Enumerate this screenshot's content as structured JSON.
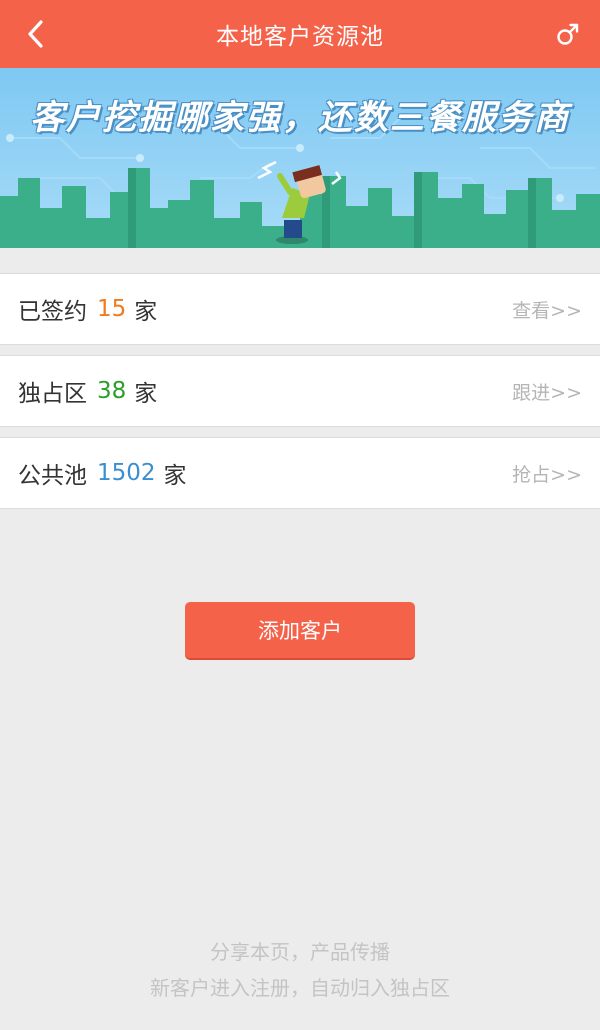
{
  "header": {
    "title": "本地客户资源池",
    "back_icon": "chevron-left-icon",
    "right_icon": "male-symbol-icon",
    "color": "#f5624a"
  },
  "banner": {
    "slogan": "客户挖掘哪家强，还数三餐服务商"
  },
  "rows": [
    {
      "label": "已签约",
      "count": "15",
      "unit": "家",
      "action": "查看>>",
      "count_color": "#f07b1e"
    },
    {
      "label": "独占区",
      "count": "38",
      "unit": "家",
      "action": "跟进>>",
      "count_color": "#2c9e2c"
    },
    {
      "label": "公共池",
      "count": "1502",
      "unit": "家",
      "action": "抢占>>",
      "count_color": "#3a8fd0"
    }
  ],
  "add_button": {
    "label": "添加客户"
  },
  "footer": {
    "line1": "分享本页，产品传播",
    "line2": "新客户进入注册，自动归入独占区"
  }
}
